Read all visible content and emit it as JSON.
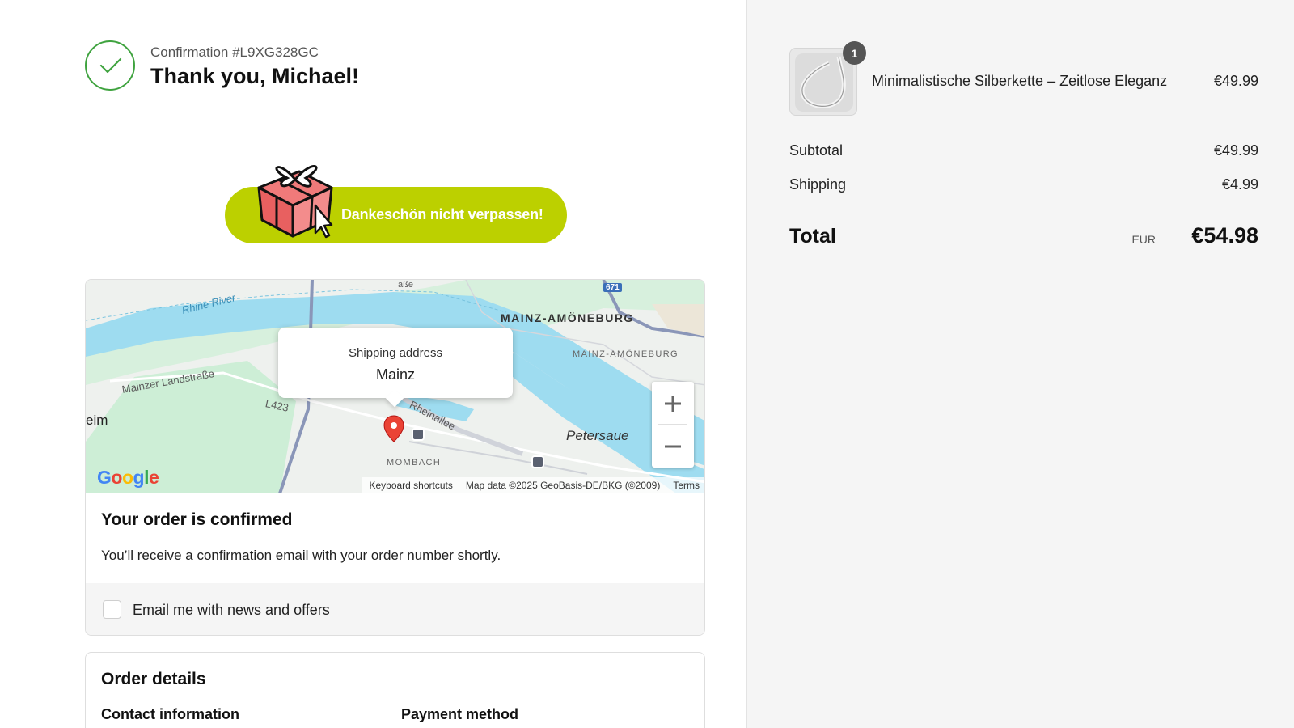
{
  "header": {
    "confirmation_number": "Confirmation #L9XG328GC",
    "title": "Thank you, Michael!"
  },
  "banner": {
    "text": "Dankeschön nicht verpassen!"
  },
  "map": {
    "popup_title": "Shipping address",
    "popup_city": "Mainz",
    "labels": {
      "river": "Rhine River",
      "area_city": "MAINZ-AMÖNEBURG",
      "area_district": "MAINZ-AMÖNEBURG",
      "road1": "Mainzer Landstraße",
      "road2": "L423",
      "road3": "Rheinallee",
      "district2": "MOMBACH",
      "island": "Petersaue",
      "left_edge": "eim",
      "highway": "671",
      "top_road": "aße"
    },
    "footer": {
      "shortcuts": "Keyboard shortcuts",
      "data": "Map data ©2025 GeoBasis-DE/BKG (©2009)",
      "terms": "Terms"
    },
    "zoom_in": "+",
    "zoom_out": "−",
    "logo": "Google"
  },
  "confirmation": {
    "title": "Your order is confirmed",
    "text": "You’ll receive a confirmation email with your order number shortly."
  },
  "newsletter": {
    "label": "Email me with news and offers",
    "checked": false
  },
  "order_details": {
    "title": "Order details",
    "contact_heading": "Contact information",
    "payment_heading": "Payment method"
  },
  "summary": {
    "item": {
      "name": "Minimalistische Silberkette – Zeitlose Eleganz",
      "price": "€49.99",
      "quantity": "1"
    },
    "subtotal_label": "Subtotal",
    "subtotal_value": "€49.99",
    "shipping_label": "Shipping",
    "shipping_value": "€4.99",
    "total_label": "Total",
    "total_currency": "EUR",
    "total_value": "€54.98"
  },
  "colors": {
    "success": "#3fa33f",
    "banner": "#bcd000",
    "summary_bg": "#f5f5f5"
  }
}
